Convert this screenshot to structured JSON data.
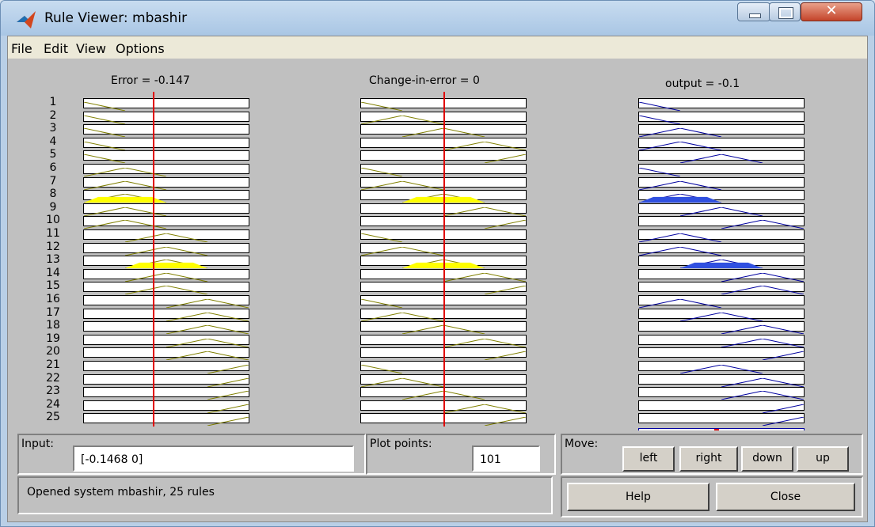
{
  "window": {
    "title": "Rule Viewer: mbashir"
  },
  "menu": [
    "File",
    "Edit",
    "View",
    "Options"
  ],
  "plots": {
    "error_title": "Error = -0.147",
    "change_title": "Change-in-error = 0",
    "output_title": "output = -0.1",
    "rule_numbers": [
      "1",
      "2",
      "3",
      "4",
      "5",
      "6",
      "7",
      "8",
      "9",
      "10",
      "11",
      "12",
      "13",
      "14",
      "15",
      "16",
      "17",
      "18",
      "19",
      "20",
      "21",
      "22",
      "23",
      "24",
      "25"
    ],
    "input_line_fraction": 0.42,
    "change_line_fraction": 0.5
  },
  "rules": {
    "error_mf": [
      0,
      0,
      0,
      0,
      0,
      1,
      1,
      1,
      1,
      1,
      2,
      2,
      2,
      2,
      2,
      3,
      3,
      3,
      3,
      3,
      4,
      4,
      4,
      4,
      4
    ],
    "change_mf": [
      0,
      1,
      2,
      3,
      4,
      0,
      1,
      2,
      3,
      4,
      0,
      1,
      2,
      3,
      4,
      0,
      1,
      2,
      3,
      4,
      0,
      1,
      2,
      3,
      4
    ],
    "output_mf": [
      0,
      0,
      1,
      1,
      2,
      0,
      1,
      1,
      2,
      3,
      1,
      1,
      2,
      3,
      3,
      1,
      2,
      3,
      3,
      4,
      2,
      3,
      3,
      4,
      4
    ],
    "fired": [
      0,
      0,
      0,
      0,
      0,
      0,
      0,
      1,
      0,
      0,
      0,
      0,
      1,
      0,
      0,
      0,
      0,
      0,
      0,
      0,
      0,
      0,
      0,
      0,
      0
    ]
  },
  "colors": {
    "input_fill": "#ffff00",
    "input_line": "#808000",
    "output_line": "#0000a0",
    "output_fill": "#3050e0",
    "marker": "#e00000"
  },
  "controls": {
    "input_label": "Input:",
    "input_value": "[-0.1468 0]",
    "plot_points_label": "Plot points:",
    "plot_points_value": "101",
    "move_label": "Move:",
    "move_buttons": [
      "left",
      "right",
      "down",
      "up"
    ],
    "help_label": "Help",
    "close_label": "Close"
  },
  "status": "Opened system mbashir, 25 rules"
}
